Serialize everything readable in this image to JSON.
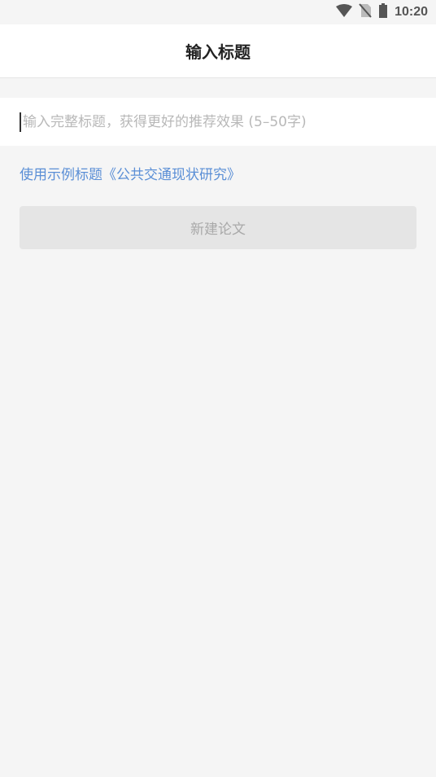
{
  "status_bar": {
    "time": "10:20",
    "icons": [
      "wifi-icon",
      "no-sim-icon",
      "battery-icon"
    ]
  },
  "header": {
    "title": "输入标题"
  },
  "title_input": {
    "value": "",
    "placeholder": "输入完整标题，获得更好的推荐效果 (5–50字)"
  },
  "example": {
    "label": "使用示例标题《公共交通现状研究》"
  },
  "create_button": {
    "label": "新建论文"
  },
  "colors": {
    "link": "#5b8fd6",
    "background": "#f5f5f5",
    "button_disabled_bg": "#e5e5e5",
    "button_disabled_text": "#a9a9a9"
  }
}
